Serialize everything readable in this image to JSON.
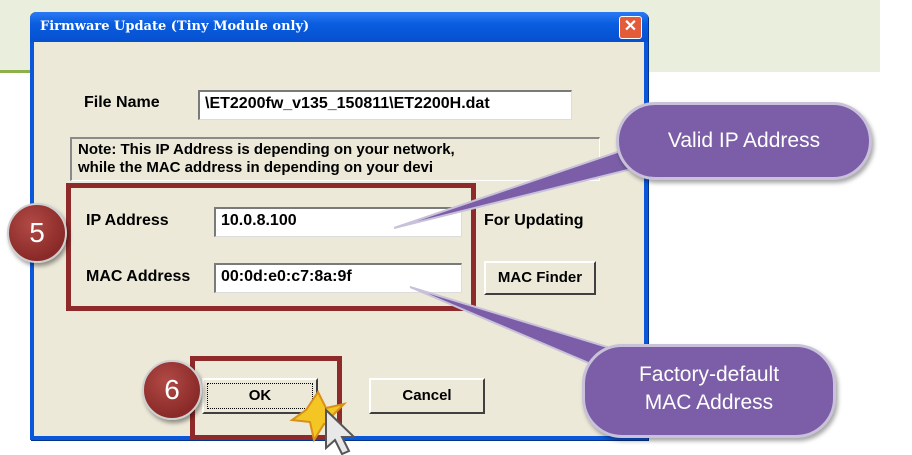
{
  "window": {
    "title": "Firmware Update (Tiny Module only)",
    "close_glyph": "✕"
  },
  "file": {
    "label": "File Name",
    "value": "\\ET2200fw_v135_150811\\ET2200H.dat"
  },
  "note": {
    "line1": "Note: This IP Address is depending on your network,",
    "line2": "while the  MAC address in depending on your devi"
  },
  "ip": {
    "label": "IP Address",
    "value": "10.0.8.100",
    "suffix": "For Updating"
  },
  "mac": {
    "label": "MAC Address",
    "value": "00:0d:e0:c7:8a:9f",
    "finder_label": "MAC Finder"
  },
  "buttons": {
    "ok": "OK",
    "cancel": "Cancel"
  },
  "annotations": {
    "step5": "5",
    "step6": "6",
    "ip_callout": "Valid IP Address",
    "mac_callout_line1": "Factory-default",
    "mac_callout_line2": "MAC Address",
    "accent_red": "#8f2a2a",
    "callout_purple": "#7b5ea7"
  }
}
